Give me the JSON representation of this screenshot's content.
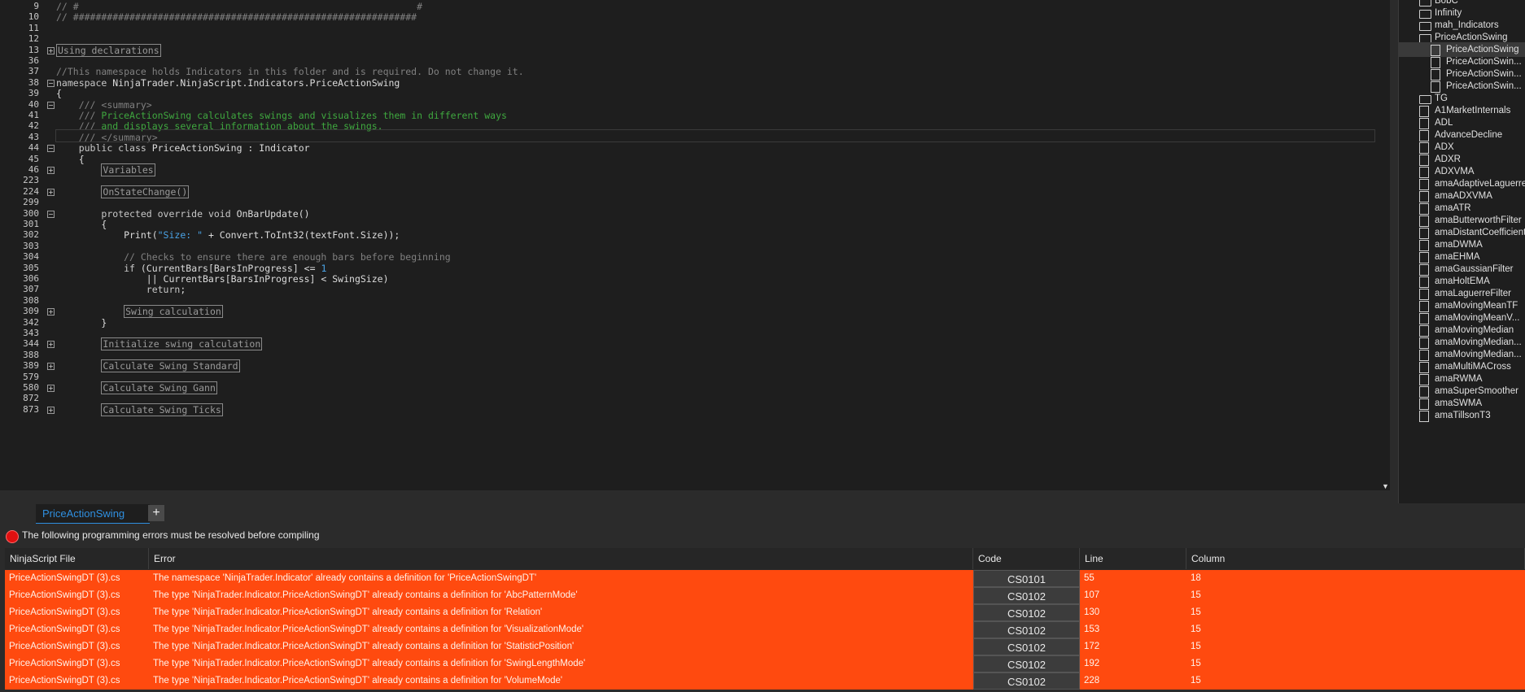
{
  "editor": {
    "lines": [
      {
        "n": "9",
        "fold": "",
        "html": "<span class='cm'>// #                                                            #</span>"
      },
      {
        "n": "10",
        "fold": "",
        "html": "<span class='cm'>// #############################################################</span>"
      },
      {
        "n": "11",
        "fold": "",
        "html": ""
      },
      {
        "n": "12",
        "fold": "",
        "html": ""
      },
      {
        "n": "13",
        "fold": "+",
        "html": "<span class='box'>Using declarations</span>"
      },
      {
        "n": "36",
        "fold": "",
        "html": ""
      },
      {
        "n": "37",
        "fold": "",
        "html": "<span class='cm'>//This namespace holds Indicators in this folder and is required. Do not change it.</span>"
      },
      {
        "n": "38",
        "fold": "-",
        "html": "<span class='kw'>namespace</span> NinjaTrader.NinjaScript.Indicators.PriceActionSwing"
      },
      {
        "n": "39",
        "fold": "",
        "html": "{"
      },
      {
        "n": "40",
        "fold": "-",
        "html": "    <span class='cm'>/// &lt;summary&gt;</span>"
      },
      {
        "n": "41",
        "fold": "",
        "html": "    <span class='cm'>///</span> <span class='gr'>PriceActionSwing calculates swings and visualizes them in different ways</span>"
      },
      {
        "n": "42",
        "fold": "",
        "html": "    <span class='cm'>///</span> <span class='gr'>and displays several information about the swings.</span>"
      },
      {
        "n": "43",
        "fold": "",
        "html": "    <span class='cm'>/// &lt;/summary&gt;</span>"
      },
      {
        "n": "44",
        "fold": "-",
        "html": "    <span class='kw'>public class</span> PriceActionSwing : Indicator"
      },
      {
        "n": "45",
        "fold": "",
        "html": "    {"
      },
      {
        "n": "46",
        "fold": "+",
        "html": "        <span class='box'>Variables</span>"
      },
      {
        "n": "223",
        "fold": "",
        "html": ""
      },
      {
        "n": "224",
        "fold": "+",
        "html": "        <span class='box'>OnStateChange()</span>"
      },
      {
        "n": "299",
        "fold": "",
        "html": ""
      },
      {
        "n": "300",
        "fold": "-",
        "html": "        <span class='kw'>protected override void</span> OnBarUpdate()"
      },
      {
        "n": "301",
        "fold": "",
        "html": "        {"
      },
      {
        "n": "302",
        "fold": "",
        "html": "            Print(<span class='str'>\"Size: \"</span> + Convert.ToInt32(textFont.Size));"
      },
      {
        "n": "303",
        "fold": "",
        "html": ""
      },
      {
        "n": "304",
        "fold": "",
        "html": "            <span class='cm'>// Checks to ensure there are enough bars before beginning</span>"
      },
      {
        "n": "305",
        "fold": "",
        "html": "            <span class='kw'>if</span> (CurrentBars[BarsInProgress] &lt;= <span class='str'>1</span>"
      },
      {
        "n": "306",
        "fold": "",
        "html": "                || CurrentBars[BarsInProgress] &lt; SwingSize)"
      },
      {
        "n": "307",
        "fold": "",
        "html": "                <span class='kw'>return</span>;"
      },
      {
        "n": "308",
        "fold": "",
        "html": ""
      },
      {
        "n": "309",
        "fold": "+",
        "html": "            <span class='box'>Swing calculation</span>"
      },
      {
        "n": "342",
        "fold": "",
        "html": "        }"
      },
      {
        "n": "343",
        "fold": "",
        "html": ""
      },
      {
        "n": "344",
        "fold": "+",
        "html": "        <span class='box'>Initialize swing calculation</span>"
      },
      {
        "n": "388",
        "fold": "",
        "html": ""
      },
      {
        "n": "389",
        "fold": "+",
        "html": "        <span class='box'>Calculate Swing Standard</span>"
      },
      {
        "n": "579",
        "fold": "",
        "html": ""
      },
      {
        "n": "580",
        "fold": "+",
        "html": "        <span class='box'>Calculate Swing Gann</span>"
      },
      {
        "n": "872",
        "fold": "",
        "html": ""
      },
      {
        "n": "873",
        "fold": "+",
        "html": "        <span class='box'>Calculate Swing Ticks</span>"
      }
    ]
  },
  "tree": {
    "items": [
      {
        "label": "BobC",
        "type": "folder",
        "indent": 0
      },
      {
        "label": "Infinity",
        "type": "folder",
        "indent": 0
      },
      {
        "label": "mah_Indicators",
        "type": "folder",
        "indent": 0
      },
      {
        "label": "PriceActionSwing",
        "type": "folder",
        "indent": 0
      },
      {
        "label": "PriceActionSwing",
        "type": "file",
        "indent": 1,
        "selected": true
      },
      {
        "label": "PriceActionSwin...",
        "type": "file",
        "indent": 1
      },
      {
        "label": "PriceActionSwin...",
        "type": "file",
        "indent": 1
      },
      {
        "label": "PriceActionSwin...",
        "type": "file",
        "indent": 1
      },
      {
        "label": "TG",
        "type": "folder",
        "indent": 0
      },
      {
        "label": "A1MarketInternals",
        "type": "file",
        "indent": 0
      },
      {
        "label": "ADL",
        "type": "file",
        "indent": 0
      },
      {
        "label": "AdvanceDecline",
        "type": "file",
        "indent": 0
      },
      {
        "label": "ADX",
        "type": "file",
        "indent": 0
      },
      {
        "label": "ADXR",
        "type": "file",
        "indent": 0
      },
      {
        "label": "ADXVMA",
        "type": "file",
        "indent": 0
      },
      {
        "label": "amaAdaptiveLaguerre",
        "type": "file",
        "indent": 0
      },
      {
        "label": "amaADXVMA",
        "type": "file",
        "indent": 0
      },
      {
        "label": "amaATR",
        "type": "file",
        "indent": 0
      },
      {
        "label": "amaButterworthFilter",
        "type": "file",
        "indent": 0
      },
      {
        "label": "amaDistantCoefficient",
        "type": "file",
        "indent": 0
      },
      {
        "label": "amaDWMA",
        "type": "file",
        "indent": 0
      },
      {
        "label": "amaEHMA",
        "type": "file",
        "indent": 0
      },
      {
        "label": "amaGaussianFilter",
        "type": "file",
        "indent": 0
      },
      {
        "label": "amaHoltEMA",
        "type": "file",
        "indent": 0
      },
      {
        "label": "amaLaguerreFilter",
        "type": "file",
        "indent": 0
      },
      {
        "label": "amaMovingMeanTF",
        "type": "file",
        "indent": 0
      },
      {
        "label": "amaMovingMeanV...",
        "type": "file",
        "indent": 0
      },
      {
        "label": "amaMovingMedian",
        "type": "file",
        "indent": 0
      },
      {
        "label": "amaMovingMedian...",
        "type": "file",
        "indent": 0
      },
      {
        "label": "amaMovingMedian...",
        "type": "file",
        "indent": 0
      },
      {
        "label": "amaMultiMACross",
        "type": "file",
        "indent": 0
      },
      {
        "label": "amaRWMA",
        "type": "file",
        "indent": 0
      },
      {
        "label": "amaSuperSmoother",
        "type": "file",
        "indent": 0
      },
      {
        "label": "amaSWMA",
        "type": "file",
        "indent": 0
      },
      {
        "label": "amaTillsonT3",
        "type": "file",
        "indent": 0
      }
    ]
  },
  "tabs": {
    "active_label": "PriceActionSwing",
    "add_label": "+"
  },
  "errors": {
    "message": "The following programming errors must be resolved before compiling",
    "headers": {
      "file": "NinjaScript File",
      "error": "Error",
      "code": "Code",
      "line": "Line",
      "column": "Column"
    },
    "rows": [
      {
        "file": "PriceActionSwingDT (3).cs",
        "error": "The namespace 'NinjaTrader.Indicator' already contains a definition for 'PriceActionSwingDT'",
        "code": "CS0101",
        "line": "55",
        "column": "18"
      },
      {
        "file": "PriceActionSwingDT (3).cs",
        "error": "The type 'NinjaTrader.Indicator.PriceActionSwingDT' already contains a definition for 'AbcPatternMode'",
        "code": "CS0102",
        "line": "107",
        "column": "15"
      },
      {
        "file": "PriceActionSwingDT (3).cs",
        "error": "The type 'NinjaTrader.Indicator.PriceActionSwingDT' already contains a definition for 'Relation'",
        "code": "CS0102",
        "line": "130",
        "column": "15"
      },
      {
        "file": "PriceActionSwingDT (3).cs",
        "error": "The type 'NinjaTrader.Indicator.PriceActionSwingDT' already contains a definition for 'VisualizationMode'",
        "code": "CS0102",
        "line": "153",
        "column": "15"
      },
      {
        "file": "PriceActionSwingDT (3).cs",
        "error": "The type 'NinjaTrader.Indicator.PriceActionSwingDT' already contains a definition for 'StatisticPosition'",
        "code": "CS0102",
        "line": "172",
        "column": "15"
      },
      {
        "file": "PriceActionSwingDT (3).cs",
        "error": "The type 'NinjaTrader.Indicator.PriceActionSwingDT' already contains a definition for 'SwingLengthMode'",
        "code": "CS0102",
        "line": "192",
        "column": "15"
      },
      {
        "file": "PriceActionSwingDT (3).cs",
        "error": "The type 'NinjaTrader.Indicator.PriceActionSwingDT' already contains a definition for 'VolumeMode'",
        "code": "CS0102",
        "line": "228",
        "column": "15"
      }
    ]
  },
  "colors": {
    "error_row": "#ff4a0f",
    "tab_accent": "#2f8fe0",
    "error_icon": "#e01010"
  }
}
